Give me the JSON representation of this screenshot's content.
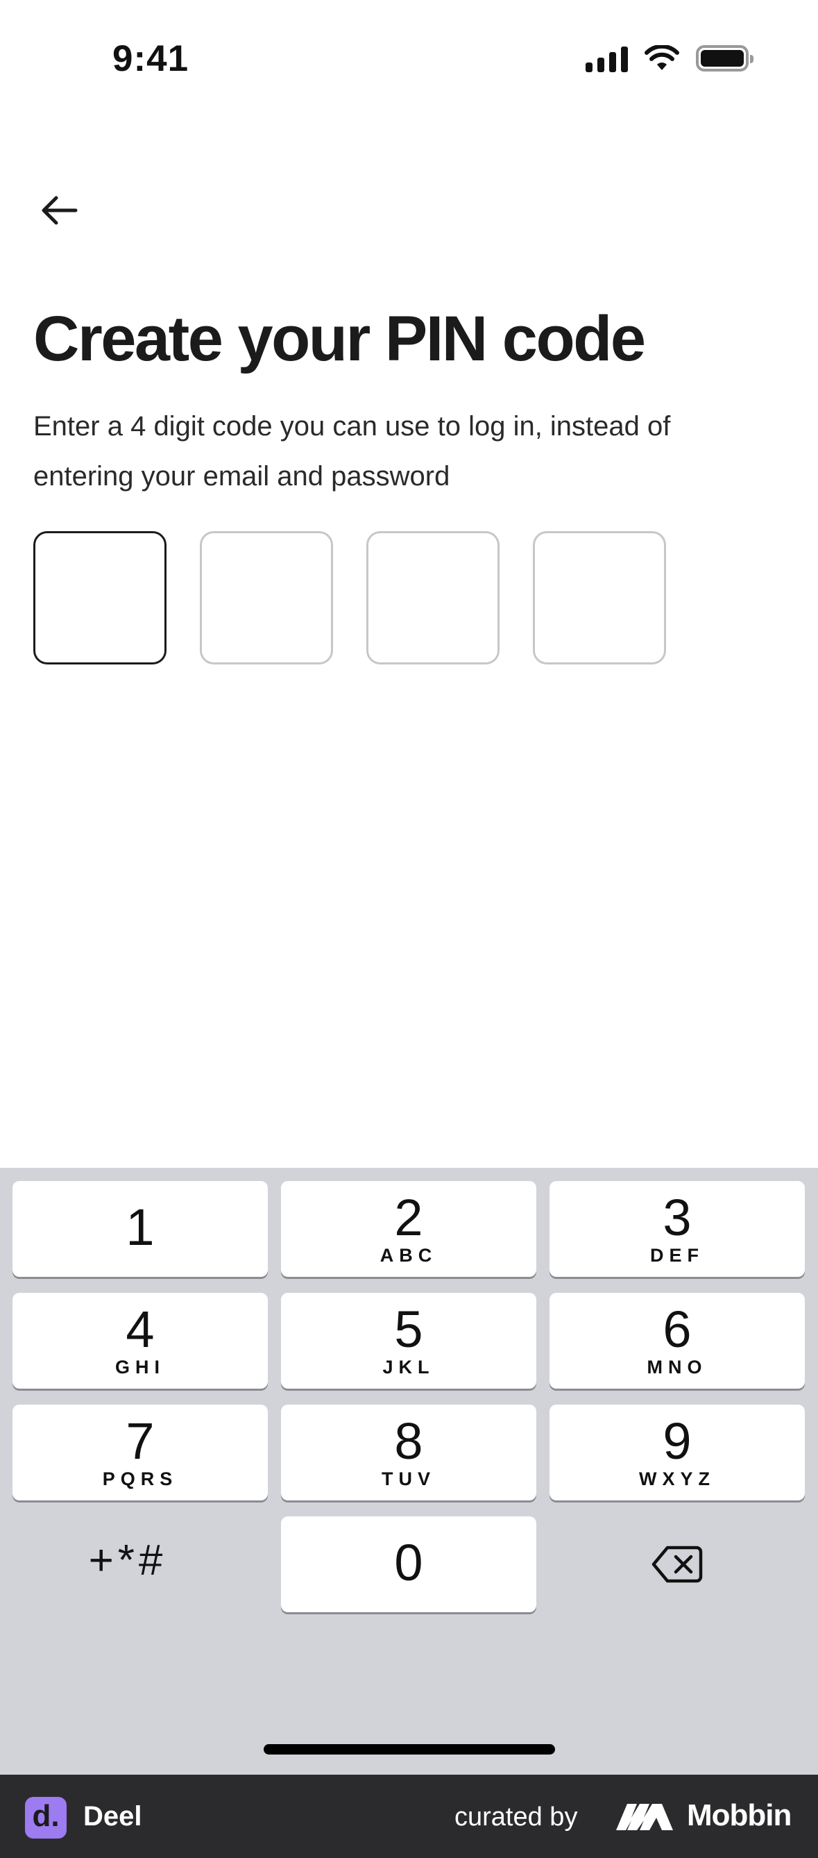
{
  "status_bar": {
    "time": "9:41"
  },
  "header": {
    "back_icon": "arrow-left-icon"
  },
  "main": {
    "title": "Create your PIN code",
    "description": "Enter a 4 digit code you can use to log in, instead of entering your email and password",
    "pin_length": 4,
    "pin_digits": [
      "",
      "",
      "",
      ""
    ]
  },
  "keypad": {
    "keys": [
      {
        "digit": "1",
        "letters": ""
      },
      {
        "digit": "2",
        "letters": "ABC"
      },
      {
        "digit": "3",
        "letters": "DEF"
      },
      {
        "digit": "4",
        "letters": "GHI"
      },
      {
        "digit": "5",
        "letters": "JKL"
      },
      {
        "digit": "6",
        "letters": "MNO"
      },
      {
        "digit": "7",
        "letters": "PQRS"
      },
      {
        "digit": "8",
        "letters": "TUV"
      },
      {
        "digit": "9",
        "letters": "WXYZ"
      },
      {
        "digit": "0",
        "letters": ""
      }
    ],
    "symbols_label": "+*#",
    "delete_icon": "backspace-icon"
  },
  "footer": {
    "app_logo_letter": "d.",
    "app_name": "Deel",
    "curated_by": "curated by",
    "brand": "Mobbin"
  },
  "colors": {
    "keypad_background": "#d1d3d9",
    "footer_background": "#2b2b2d",
    "deel_accent": "#9d7bf0",
    "active_pin_border": "#1b1b1b",
    "inactive_pin_border": "#c7c7c7"
  }
}
